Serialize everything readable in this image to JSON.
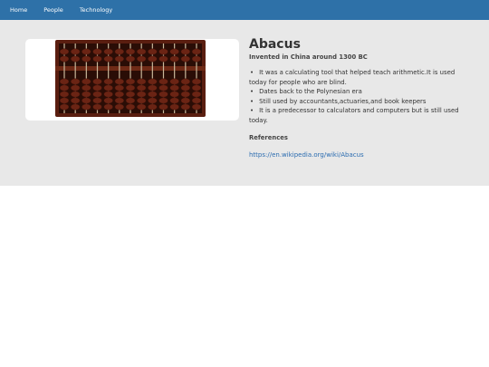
{
  "nav": {
    "items": [
      {
        "label": "Home"
      },
      {
        "label": "People"
      },
      {
        "label": "Technology"
      }
    ]
  },
  "colors": {
    "navbar": "#2e71a8",
    "hero_background": "#e8e8e8",
    "link": "#2b6cb0",
    "abacus_frame": "#5a1e10",
    "abacus_bead": "#6b2414"
  },
  "hero": {
    "image_icon": "abacus-image",
    "title": "Abacus",
    "subtitle": "Invented in China around 1300 BC",
    "facts": [
      "It was a calculating tool that helped teach arithmetic.It is used today for people who are blind.",
      "Dates back to the Polynesian era",
      "Still used by accountants,actuaries,and book keepers",
      "It is a predecessor to calculators and computers but is still used today."
    ],
    "references_heading": "References",
    "reference_link": "https://en.wikipedia.org/wiki/Abacus"
  }
}
